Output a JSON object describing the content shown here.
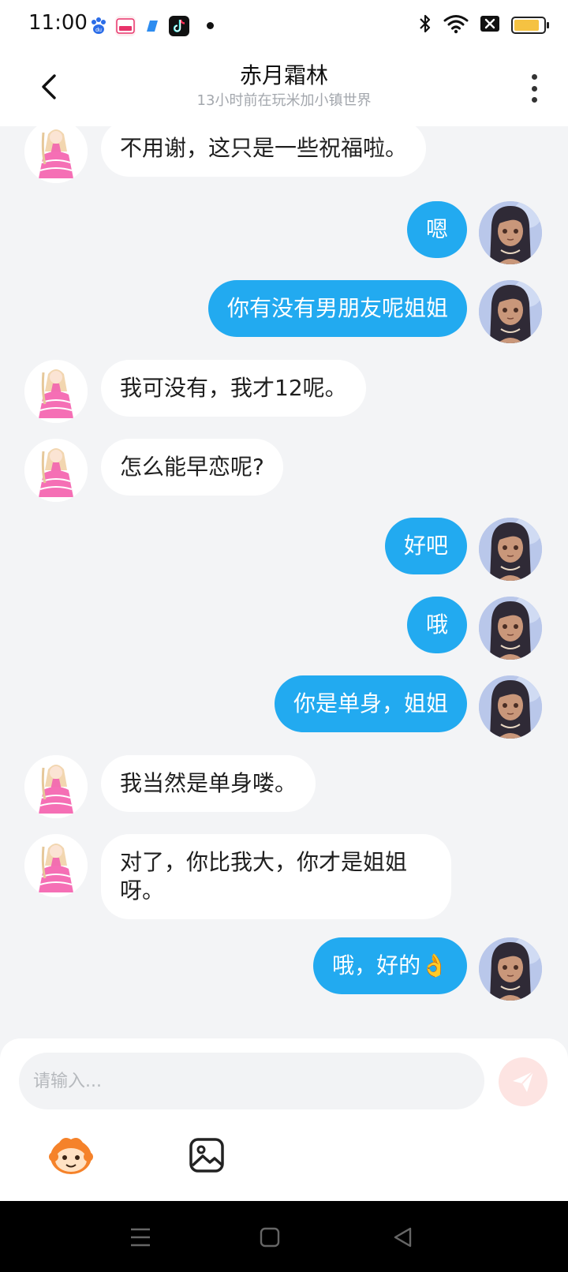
{
  "status_bar": {
    "time": "11:00",
    "battery_level": 0.85,
    "icons": [
      "baidu-app-icon",
      "hongbao-app-icon",
      "blue-app-icon",
      "tiktok-icon",
      "bluetooth-icon",
      "wifi-icon",
      "sim-off-icon",
      "battery-icon"
    ]
  },
  "header": {
    "title": "赤月霜林",
    "subtitle": "13小时前在玩米加小镇世界"
  },
  "messages": [
    {
      "side": "left",
      "text": "不用谢，这只是一些祝福啦。"
    },
    {
      "side": "right",
      "text": "嗯"
    },
    {
      "side": "right",
      "text": "你有没有男朋友呢姐姐"
    },
    {
      "side": "left",
      "text": "我可没有，我才12呢。"
    },
    {
      "side": "left",
      "text": "怎么能早恋呢?"
    },
    {
      "side": "right",
      "text": "好吧"
    },
    {
      "side": "right",
      "text": "哦"
    },
    {
      "side": "right",
      "text": "你是单身，姐姐"
    },
    {
      "side": "left",
      "text": "我当然是单身喽。"
    },
    {
      "side": "left",
      "text": "对了，你比我大，你才是姐姐呀。"
    },
    {
      "side": "right",
      "text": "哦，好的👌"
    }
  ],
  "composer": {
    "placeholder": "请输入..."
  },
  "colors": {
    "accent": "#22aaf0",
    "background": "#f3f4f6",
    "send_button": "#fde4e2"
  }
}
